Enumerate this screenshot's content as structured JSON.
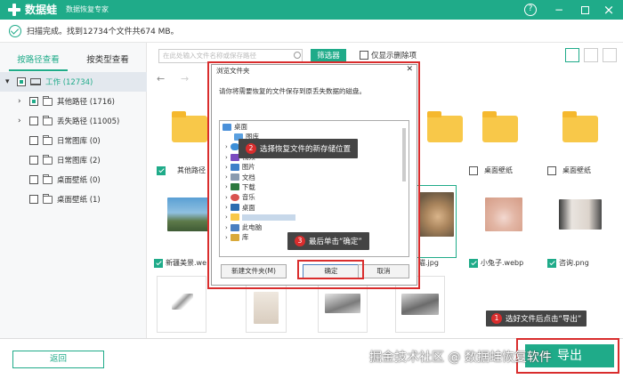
{
  "app": {
    "name": "数据蛙",
    "subtitle": "数据恢复专家",
    "controls": {
      "help": "?",
      "minimize": "−",
      "close": "×"
    }
  },
  "scan": {
    "status": "扫描完成。找到12734个文件共674 MB。"
  },
  "left_tabs": [
    {
      "label": "按路径查看",
      "active": true
    },
    {
      "label": "按类型查看",
      "active": false
    }
  ],
  "tree": [
    {
      "label": "工作 (12734)",
      "level": 0
    },
    {
      "label": "其他路径 (1716)",
      "level": 1,
      "expandable": true
    },
    {
      "label": "丢失路径 (11005)",
      "level": 1,
      "expandable": true
    },
    {
      "label": "日常图库 (0)",
      "level": 1
    },
    {
      "label": "日常图库 (2)",
      "level": 1
    },
    {
      "label": "桌面壁纸 (0)",
      "level": 1
    },
    {
      "label": "桌面壁纸 (1)",
      "level": 1
    }
  ],
  "toolbar": {
    "search_placeholder": "在此处输入文件名称或保存路径",
    "filter_label": "筛选器",
    "only_deleted": "仅显示删除项"
  },
  "grid": {
    "row1_labels": [
      "其他路径",
      "桌面壁纸",
      "桌面壁纸"
    ],
    "row2_labels": [
      "新疆美景.we",
      "猫.jpg",
      "小兔子.webp",
      "咨询.png"
    ]
  },
  "dialog": {
    "title": "浏览文件夹",
    "message": "请你将需要恢复的文件保存到原丢失数据的磁盘。",
    "tree": [
      "桌面",
      "图库",
      "",
      "视频",
      "图片",
      "文档",
      "下载",
      "音乐",
      "桌面",
      "",
      "此电脑",
      "库"
    ],
    "new_folder": "新建文件夹(M)",
    "ok": "确定",
    "cancel": "取消"
  },
  "callouts": [
    {
      "num": "1",
      "text": "选好文件后点击“导出”"
    },
    {
      "num": "2",
      "text": "选择恢复文件的新存储位置"
    },
    {
      "num": "3",
      "text": "最后单击“确定”"
    }
  ],
  "bottom": {
    "back": "返回",
    "export": "导出"
  },
  "watermark": "掘金技术社区 @ 数据蛙恢复软件",
  "colors": {
    "brand": "#1fab89",
    "highlight": "#d92d2d"
  }
}
